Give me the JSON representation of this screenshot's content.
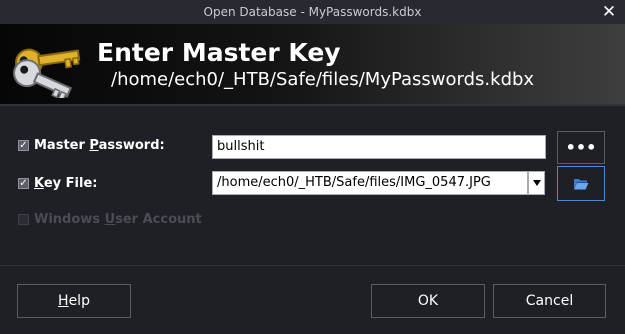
{
  "window": {
    "title": "Open Database - MyPasswords.kdbx",
    "close_glyph": "✕"
  },
  "banner": {
    "heading": "Enter Master Key",
    "path": "/home/ech0/_HTB/Safe/files/MyPasswords.kdbx",
    "icon": "key-icon"
  },
  "form": {
    "master_password": {
      "checked": true,
      "label_pre": "Master ",
      "label_accel": "P",
      "label_post": "assword:",
      "value": "bullshit",
      "reveal_glyph": "•••"
    },
    "key_file": {
      "checked": true,
      "label_accel": "K",
      "label_post": "ey File:",
      "value": "/home/ech0/_HTB/Safe/files/IMG_0547.JPG",
      "browse_icon": "folder-open-icon"
    },
    "windows_account": {
      "checked": false,
      "enabled": false,
      "label_pre": "Windows ",
      "label_accel": "U",
      "label_post": "ser Account"
    }
  },
  "buttons": {
    "help_accel": "H",
    "help_rest": "elp",
    "ok": "OK",
    "cancel": "Cancel"
  },
  "colors": {
    "background": "#1e2026",
    "focus_border": "#4f88d1"
  }
}
